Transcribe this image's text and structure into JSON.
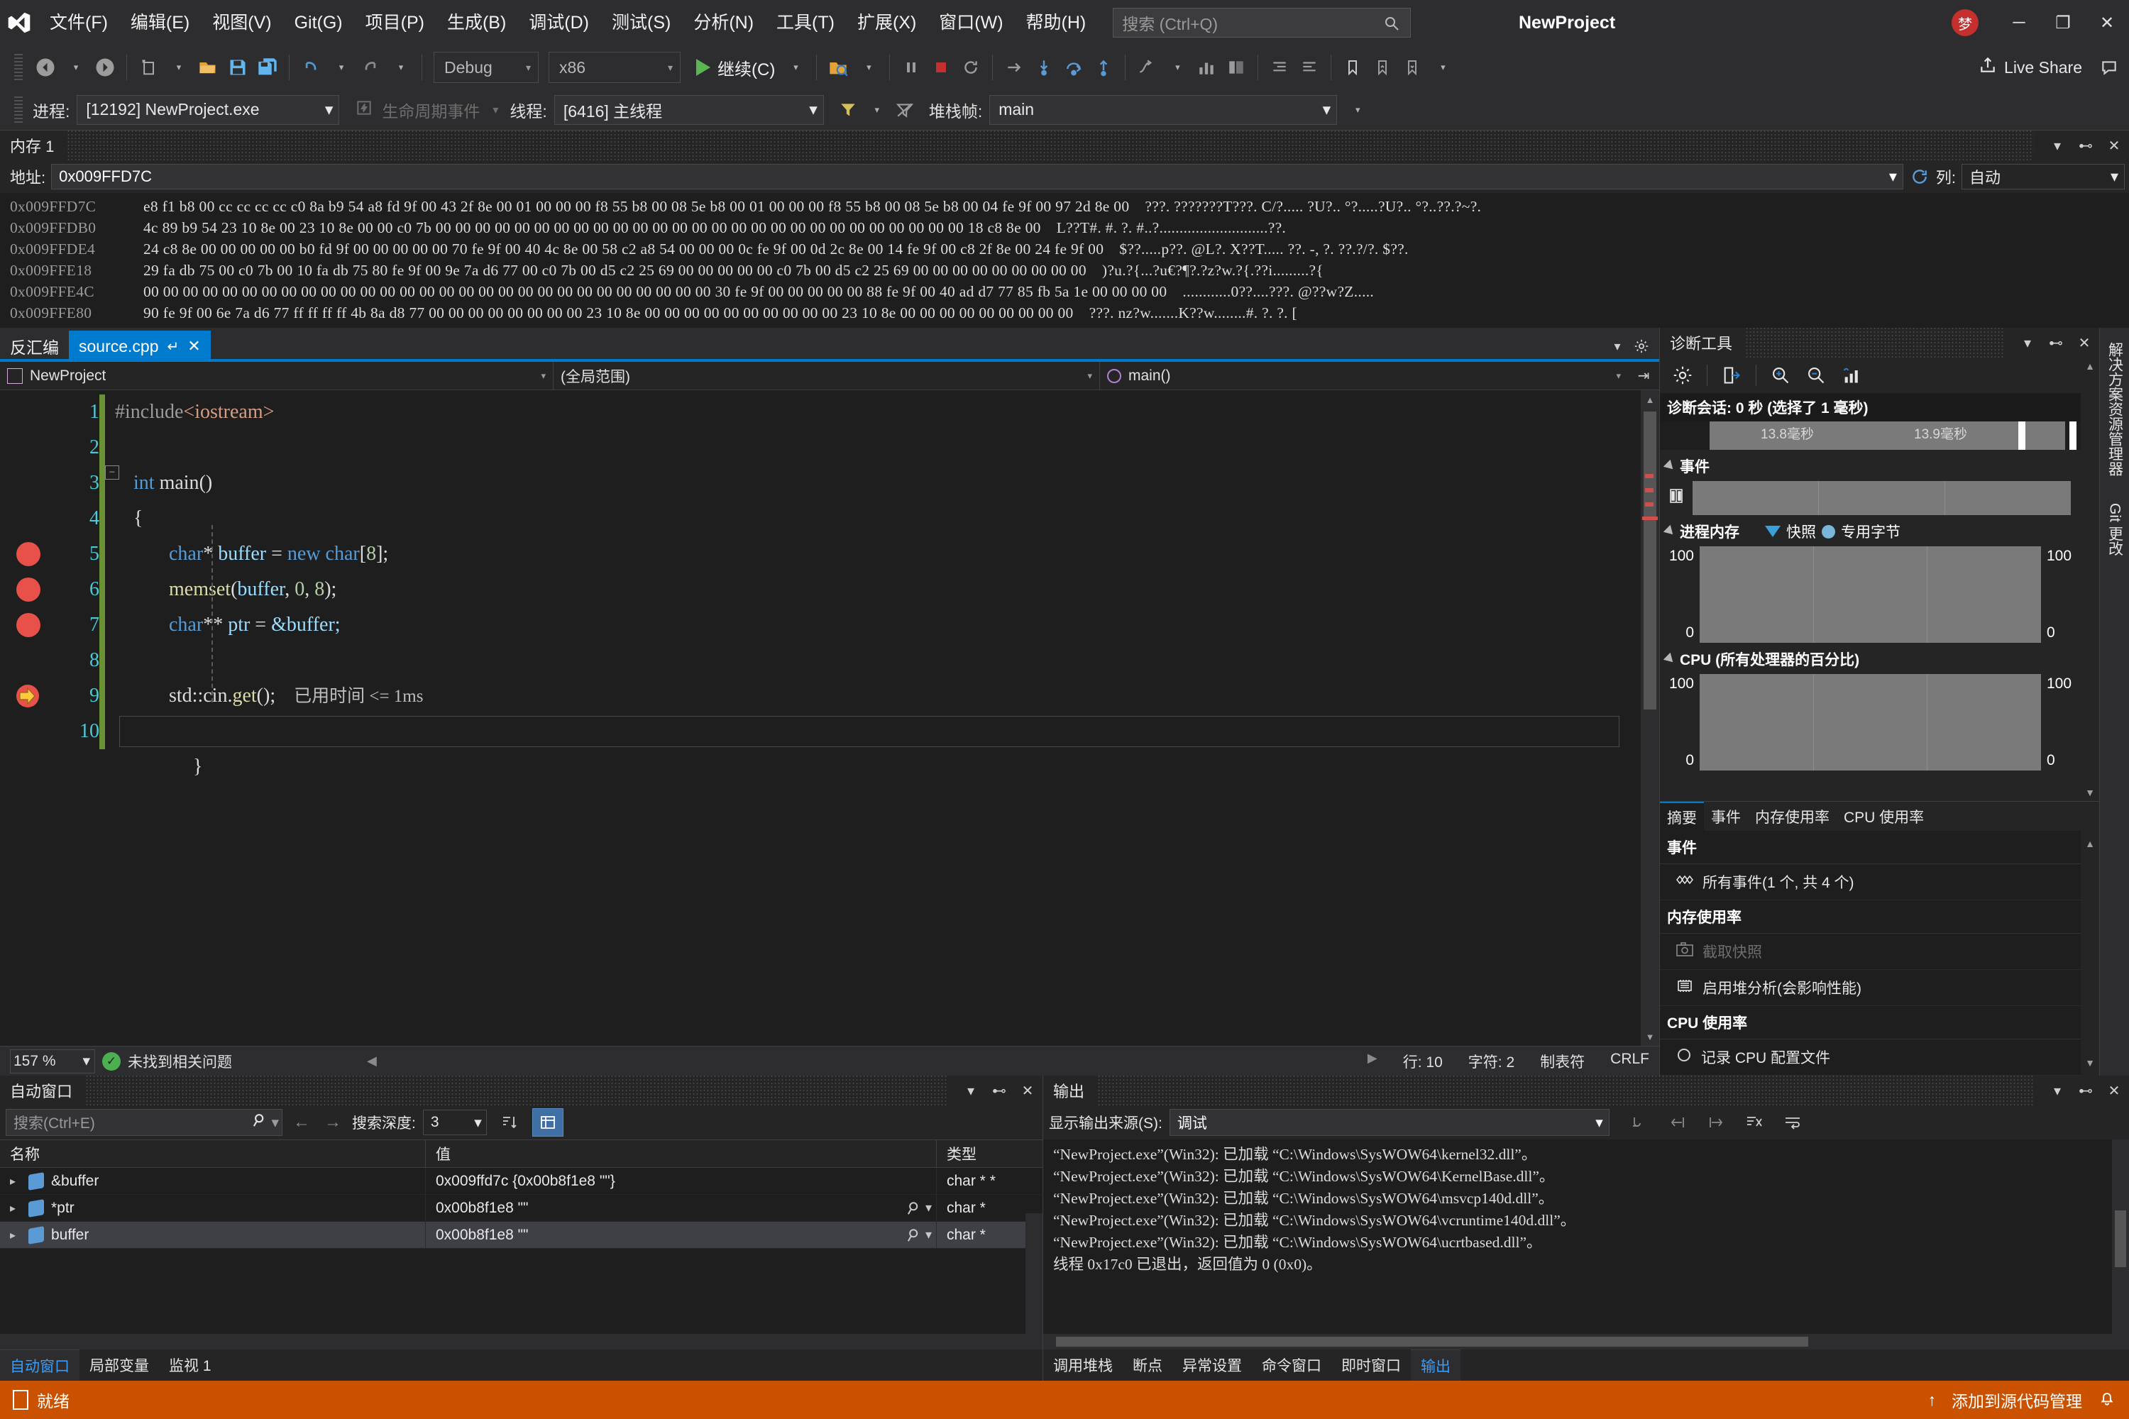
{
  "titlebar": {
    "menu": [
      {
        "label": "文件(F)"
      },
      {
        "label": "编辑(E)"
      },
      {
        "label": "视图(V)"
      },
      {
        "label": "Git(G)"
      },
      {
        "label": "项目(P)"
      },
      {
        "label": "生成(B)"
      },
      {
        "label": "调试(D)"
      },
      {
        "label": "测试(S)"
      },
      {
        "label": "分析(N)"
      },
      {
        "label": "工具(T)"
      },
      {
        "label": "扩展(X)"
      },
      {
        "label": "窗口(W)"
      },
      {
        "label": "帮助(H)"
      }
    ],
    "search_placeholder": "搜索 (Ctrl+Q)",
    "project_name": "NewProject",
    "account_badge": "梦",
    "minimize": "─",
    "maximize": "❐",
    "close": "✕"
  },
  "toolbar": {
    "back_icon": "←",
    "forward_icon": "→",
    "new_icon": "new-file",
    "open_icon": "open-folder",
    "save_icon": "save",
    "save_all_icon": "save-all",
    "undo_icon": "↶",
    "redo_icon": "↷",
    "config": "Debug",
    "platform": "x86",
    "continue_label": "继续(C)",
    "live_share": "Live Share",
    "icons": [
      "pause",
      "stop",
      "restart",
      "show-next",
      "step-into",
      "step-over",
      "step-out",
      "threads",
      "stack",
      "modules",
      "bookmark",
      "prev-bookmark",
      "next-bookmark"
    ]
  },
  "debugbar": {
    "process_label": "进程:",
    "process_value": "[12192] NewProject.exe",
    "lifecycle_label": "生命周期事件",
    "thread_label": "线程:",
    "thread_value": "[6416] 主线程",
    "stackframe_label": "堆栈帧:",
    "stackframe_value": "main"
  },
  "memory": {
    "title": "内存 1",
    "addr_label": "地址:",
    "addr_value": "0x009FFD7C",
    "col_label": "列:",
    "col_value": "自动",
    "refresh_icon": "refresh",
    "rows": [
      {
        "addr": "0x009FFD7C",
        "hex": "e8 f1 b8 00 cc cc cc cc c0 8a b9 54 a8 fd 9f 00 43 2f 8e 00 01 00 00 00 f8 55 b8 00 08 5e b8 00 01 00 00 00 f8 55 b8 00 08 5e b8 00 04 fe 9f 00 97 2d 8e 00",
        "ascii": "???. ???????T???. C/?..... ?U?.. °?.....?U?.. °?..??.?~?."
      },
      {
        "addr": "0x009FFDB0",
        "hex": "4c 89 b9 54 23 10 8e 00 23 10 8e 00 00 c0 7b 00 00 00 00 00 00 00 00 00 00 00 00 00 00 00 00 00 00 00 00 00 00 00 00 00 00 00 18 c8 8e 00",
        "ascii": "L??T#. #. ?. #..?...........................??."
      },
      {
        "addr": "0x009FFDE4",
        "hex": "24 c8 8e 00 00 00 00 00 b0 fd 9f 00 00 00 00 00 70 fe 9f 00 40 4c 8e 00 58 c2 a8 54 00 00 00 0c fe 9f 00 0d 2c 8e 00 14 fe 9f 00 c8 2f 8e 00 24 fe 9f 00",
        "ascii": "$??.....p??. @L?. X??T..... ??. -, ?. ??.?/?. $??."
      },
      {
        "addr": "0x009FFE18",
        "hex": "29 fa db 75 00 c0 7b 00 10 fa db 75 80 fe 9f 00 9e 7a d6 77 00 c0 7b 00 d5 c2 25 69 00 00 00 00 00 c0 7b 00 d5 c2 25 69 00 00 00 00 00 00 00 00 00",
        "ascii": ")?u.?{...?u€?¶?.?z?w.?{.??i.........?{"
      },
      {
        "addr": "0x009FFE4C",
        "hex": "00 00 00 00 00 00 00 00 00 00 00 00 00 00 00 00 00 00 00 00 00 00 00 00 00 00 00 00 00 30 fe 9f 00 00 00 00 00 88 fe 9f 00 40 ad d7 77 85 fb 5a 1e 00 00 00 00",
        "ascii": "............0??....???. @??w?Z....."
      },
      {
        "addr": "0x009FFE80",
        "hex": "90 fe 9f 00 6e 7a d6 77 ff ff ff ff 4b 8a d8 77 00 00 00 00 00 00 00 00 23 10 8e 00 00 00 00 00 00 00 00 00 00 23 10 8e 00 00 00 00 00 00 00 00 00",
        "ascii": "???. nz?w.......K??w........#. ?. ?. ["
      }
    ]
  },
  "editor": {
    "tabs": [
      {
        "label": "反汇编",
        "active": false
      },
      {
        "label": "source.cpp",
        "active": true,
        "pin": "↵",
        "close": "✕"
      }
    ],
    "nav": {
      "project": "NewProject",
      "scope": "(全局范围)",
      "member": "main()"
    },
    "lines": [
      {
        "num": "1",
        "breakpoint": "none"
      },
      {
        "num": "2",
        "breakpoint": "none"
      },
      {
        "num": "3",
        "breakpoint": "none"
      },
      {
        "num": "4",
        "breakpoint": "none"
      },
      {
        "num": "5",
        "breakpoint": "dot"
      },
      {
        "num": "6",
        "breakpoint": "dot"
      },
      {
        "num": "7",
        "breakpoint": "dot"
      },
      {
        "num": "8",
        "breakpoint": "none"
      },
      {
        "num": "9",
        "breakpoint": "current"
      },
      {
        "num": "10",
        "breakpoint": "none"
      }
    ],
    "code": {
      "l1_include": "#include",
      "l1_header": "<iostream>",
      "l3_int": "int",
      "l3_main": " main",
      "l3_paren": "()",
      "l4_brace": "{",
      "l5_type": "char",
      "l5_star": "* ",
      "l5_var": "buffer",
      "l5_eq": " = ",
      "l5_new": "new",
      "l5_type2": " char",
      "l5_idx": "[",
      "l5_num": "8",
      "l5_end": "];",
      "l6_fn": "memset",
      "l6_open": "(",
      "l6_arg1": "buffer",
      "l6_c1": ", ",
      "l6_num1": "0",
      "l6_c2": ", ",
      "l6_num2": "8",
      "l6_close": ");",
      "l7_type": "char",
      "l7_stars": "** ",
      "l7_var": "ptr",
      "l7_eq": " = ",
      "l7_amp": "&buffer;",
      "l9_std": "std::cin.",
      "l9_get": "get",
      "l9_paren": "();",
      "l9_tip": "已用时间 <= 1ms",
      "l10_brace": "}"
    },
    "status": {
      "zoom": "157 %",
      "issues": "未找到相关问题",
      "line": "行: 10",
      "char": "字符: 2",
      "tabs": "制表符",
      "eol": "CRLF"
    }
  },
  "diagnostics": {
    "title": "诊断工具",
    "toolbar_icons": [
      "settings-gear",
      "export",
      "zoom-in",
      "zoom-out",
      "chart"
    ],
    "session": "诊断会话: 0 秒 (选择了 1 毫秒)",
    "ruler": {
      "t1": "13.8毫秒",
      "t2": "13.9毫秒"
    },
    "events_section": "事件",
    "memory_section": "进程内存",
    "memory_legend": {
      "snapshot": "快照",
      "private_bytes": "专用字节"
    },
    "cpu_section": "CPU (所有处理器的百分比)",
    "axis": {
      "max": "100",
      "min": "0"
    },
    "tabs": [
      {
        "label": "摘要",
        "active": true
      },
      {
        "label": "事件",
        "active": false
      },
      {
        "label": "内存使用率",
        "active": false
      },
      {
        "label": "CPU 使用率",
        "active": false
      }
    ],
    "summary": [
      {
        "type": "head",
        "label": "事件"
      },
      {
        "type": "item",
        "label": "所有事件(1 个, 共 4 个)",
        "icon": "events-icon",
        "dimmed": false
      },
      {
        "type": "head",
        "label": "内存使用率"
      },
      {
        "type": "item",
        "label": "截取快照",
        "icon": "camera-icon",
        "dimmed": true
      },
      {
        "type": "item",
        "label": "启用堆分析(会影响性能)",
        "icon": "heap-icon",
        "dimmed": false
      },
      {
        "type": "head",
        "label": "CPU 使用率"
      },
      {
        "type": "item",
        "label": "记录 CPU 配置文件",
        "icon": "record-icon",
        "dimmed": false
      }
    ]
  },
  "rail": {
    "tabs": [
      "解决方案资源管理器",
      "Git 更改"
    ]
  },
  "autos": {
    "title": "自动窗口",
    "search_placeholder": "搜索(Ctrl+E)",
    "depth_label": "搜索深度:",
    "depth_value": "3",
    "columns": [
      "名称",
      "值",
      "类型"
    ],
    "rows": [
      {
        "name": "&buffer",
        "value": "0x009ffd7c {0x00b8f1e8 \"\"}",
        "type": "char * *",
        "selected": false,
        "magnifier": false
      },
      {
        "name": "*ptr",
        "value": "0x00b8f1e8 \"\"",
        "type": "char *",
        "selected": false,
        "magnifier": true
      },
      {
        "name": "buffer",
        "value": "0x00b8f1e8 \"\"",
        "type": "char *",
        "selected": true,
        "magnifier": true
      }
    ],
    "tabs": [
      {
        "label": "自动窗口",
        "active": true
      },
      {
        "label": "局部变量",
        "active": false
      },
      {
        "label": "监视 1",
        "active": false
      }
    ]
  },
  "output": {
    "title": "输出",
    "source_label": "显示输出来源(S):",
    "source_value": "调试",
    "lines": [
      "“NewProject.exe”(Win32): 已加载 “C:\\Windows\\SysWOW64\\kernel32.dll”。",
      "“NewProject.exe”(Win32): 已加载 “C:\\Windows\\SysWOW64\\KernelBase.dll”。",
      "“NewProject.exe”(Win32): 已加载 “C:\\Windows\\SysWOW64\\msvcp140d.dll”。",
      "“NewProject.exe”(Win32): 已加载 “C:\\Windows\\SysWOW64\\vcruntime140d.dll”。",
      "“NewProject.exe”(Win32): 已加载 “C:\\Windows\\SysWOW64\\ucrtbased.dll”。",
      "线程 0x17c0 已退出，返回值为 0 (0x0)。"
    ],
    "tabs": [
      {
        "label": "调用堆栈",
        "active": false
      },
      {
        "label": "断点",
        "active": false
      },
      {
        "label": "异常设置",
        "active": false
      },
      {
        "label": "命令窗口",
        "active": false
      },
      {
        "label": "即时窗口",
        "active": false
      },
      {
        "label": "输出",
        "active": true
      }
    ]
  },
  "statusbar": {
    "state": "就绪",
    "source_control": "添加到源代码管理",
    "up_arrow": "↑",
    "bell": "ὑ4"
  },
  "colors": {
    "accent": "#007acc",
    "status_orange": "#ca5100",
    "breakpoint_red": "#e8504a",
    "current_yellow": "#ffc83d",
    "green_run": "#5ab552"
  }
}
